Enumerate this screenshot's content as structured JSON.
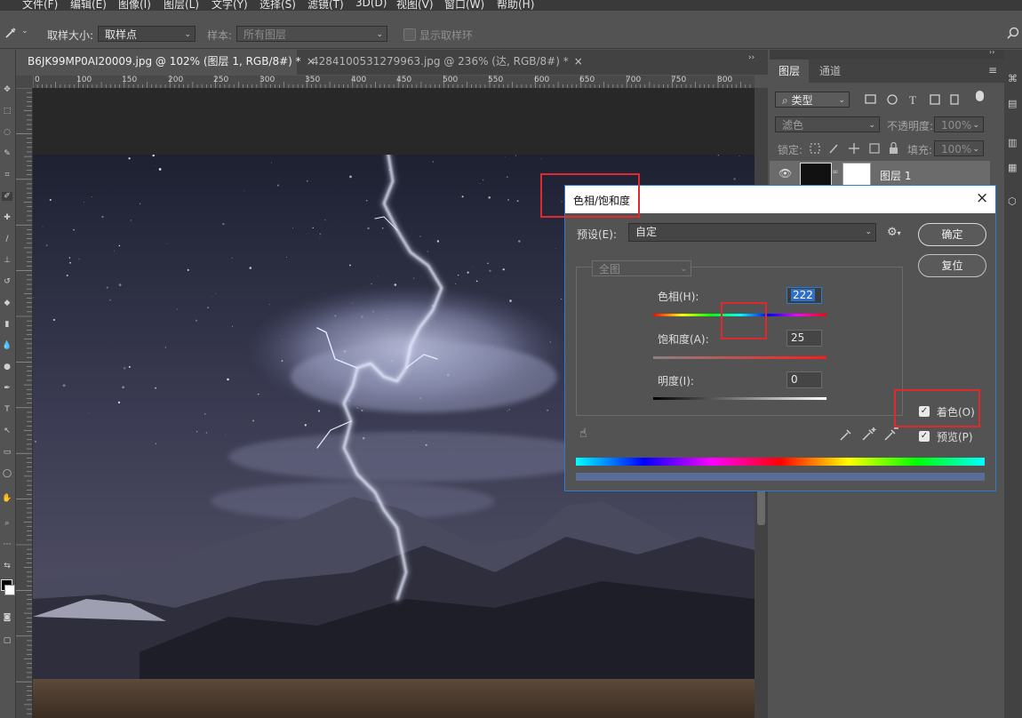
{
  "menu": [
    "文件(F)",
    "编辑(E)",
    "图像(I)",
    "图层(L)",
    "文字(Y)",
    "选择(S)",
    "滤镜(T)",
    "3D(D)",
    "视图(V)",
    "窗口(W)",
    "帮助(H)"
  ],
  "options_bar": {
    "sample_size_label": "取样大小:",
    "sample_size_value": "取样点",
    "sample_label": "样本:",
    "sample_value": "所有图层",
    "show_ring_label": "显示取样环"
  },
  "tabs": [
    {
      "label": "B6JK99MP0AI20009.jpg @ 102% (图层 1, RGB/8#) *",
      "close": "×"
    },
    {
      "label": "4284100531279963.jpg @ 236% (达, RGB/8#) *",
      "close": "×"
    }
  ],
  "ruler_ticks": [
    "0",
    "100",
    "150",
    "200",
    "250",
    "300",
    "350",
    "400",
    "450",
    "500",
    "550",
    "600",
    "650",
    "700",
    "750",
    "800"
  ],
  "layers_panel": {
    "tab_layers": "图层",
    "tab_channels": "通道",
    "filter_kind": "类型",
    "blend_mode": "滤色",
    "opacity_label": "不透明度:",
    "opacity_value": "100%",
    "lock_label": "锁定:",
    "fill_label": "填充:",
    "fill_value": "100%",
    "layer_name": "图层 1"
  },
  "dialog": {
    "title": "色相/饱和度",
    "preset_label": "预设(E):",
    "preset_value": "自定",
    "channel_value": "全图",
    "hue_label": "色相(H):",
    "hue_value": "222",
    "hue_fraction": 0.8083,
    "saturation_label": "饱和度(A):",
    "saturation_value": "25",
    "saturation_fraction": 0.25,
    "lightness_label": "明度(I):",
    "lightness_value": "0",
    "lightness_fraction": 0.5,
    "ok_label": "确定",
    "reset_label": "复位",
    "colorize_label": "着色(O)",
    "colorize_checked": true,
    "preview_label": "预览(P)",
    "preview_checked": true,
    "close": "×",
    "colorized_bar_color": "#5a6d96"
  },
  "colors": {
    "annotation_red": "#e0292f",
    "dialog_border": "#2e7bd3",
    "ui_gray": "#535353"
  }
}
